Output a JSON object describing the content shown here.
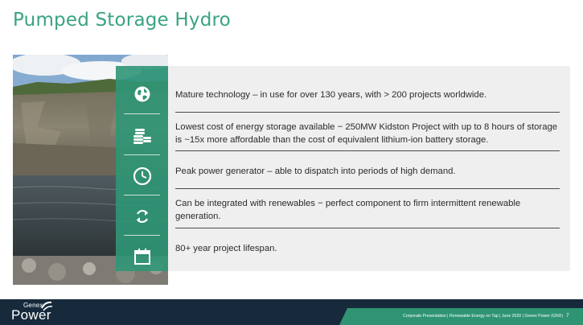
{
  "slide": {
    "title": "Pumped Storage Hydro"
  },
  "bullets": [
    {
      "icon": "globe-icon",
      "text": "Mature technology – in use for over 130 years, with > 200 projects worldwide."
    },
    {
      "icon": "coins-icon",
      "text": "Lowest cost of energy storage available − 250MW Kidston Project with up to 8 hours of storage is ~15x more affordable than the cost of equivalent lithium-ion battery storage."
    },
    {
      "icon": "clock-icon",
      "text": "Peak power generator – able to dispatch into periods of high demand."
    },
    {
      "icon": "refresh-icon",
      "text": "Can be integrated with renewables − perfect component to firm intermittent renewable generation."
    },
    {
      "icon": "calendar-icon",
      "text": "80+ year project lifespan."
    }
  ],
  "footer": {
    "logo_top": "Genex",
    "logo_bottom": "Power",
    "text": "Corporate Presentation  |  Renewable Energy on Tap  |  June 2020  |  Genex Power (GNX)",
    "page_number": "7"
  },
  "colors": {
    "accent": "#3aa383",
    "icon_column": "#2f9676",
    "footer_bg": "#162a3c",
    "footer_band": "#2e9473"
  }
}
